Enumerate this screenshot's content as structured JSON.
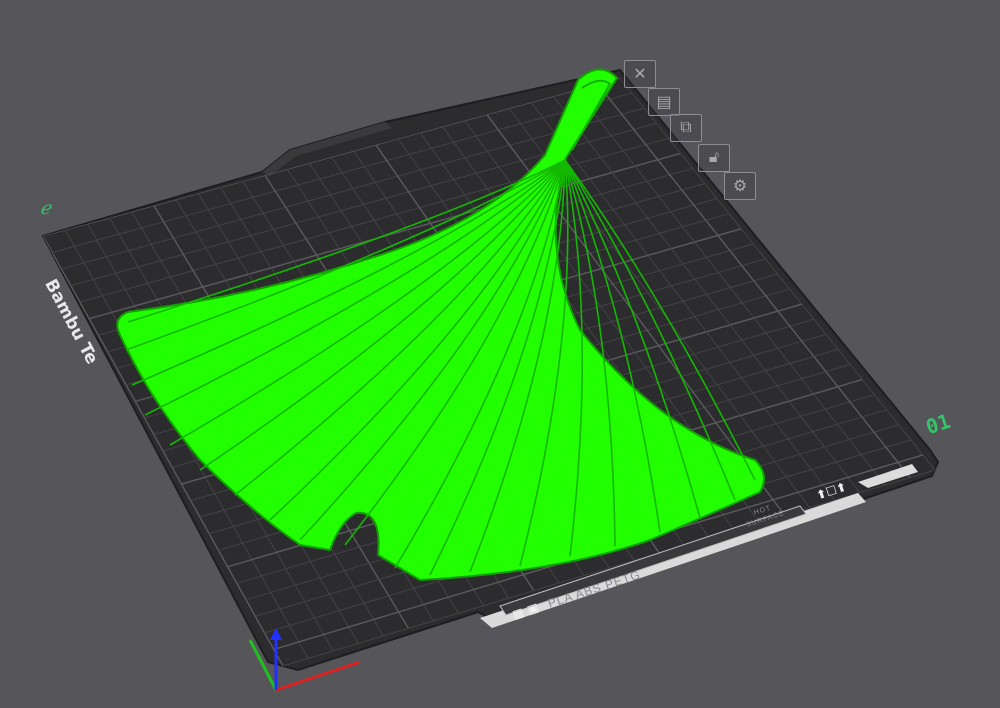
{
  "viewport": {
    "background": "#55555a",
    "plate_color": "#2c2c2e",
    "grid_color": "#4a4a4e",
    "model_color": "#22ff00",
    "model_edge_color": "#14a800"
  },
  "plate": {
    "brand_label": "Bambu Te",
    "plate_number": "01",
    "view_marker": "ℯ",
    "material_text": "PLA ABS PETG",
    "mini_label_line1": "HOT",
    "mini_label_line2": "SURFACE"
  },
  "plate_tools": [
    {
      "name": "close-plate",
      "icon": "close-icon"
    },
    {
      "name": "arrange",
      "icon": "arrange-icon"
    },
    {
      "name": "auto-orient",
      "icon": "orient-icon"
    },
    {
      "name": "lock",
      "icon": "lock-icon"
    },
    {
      "name": "plate-settings",
      "icon": "gear-icon"
    }
  ],
  "axes": {
    "x_color": "#e02020",
    "y_color": "#20c020",
    "z_color": "#2030ff"
  }
}
